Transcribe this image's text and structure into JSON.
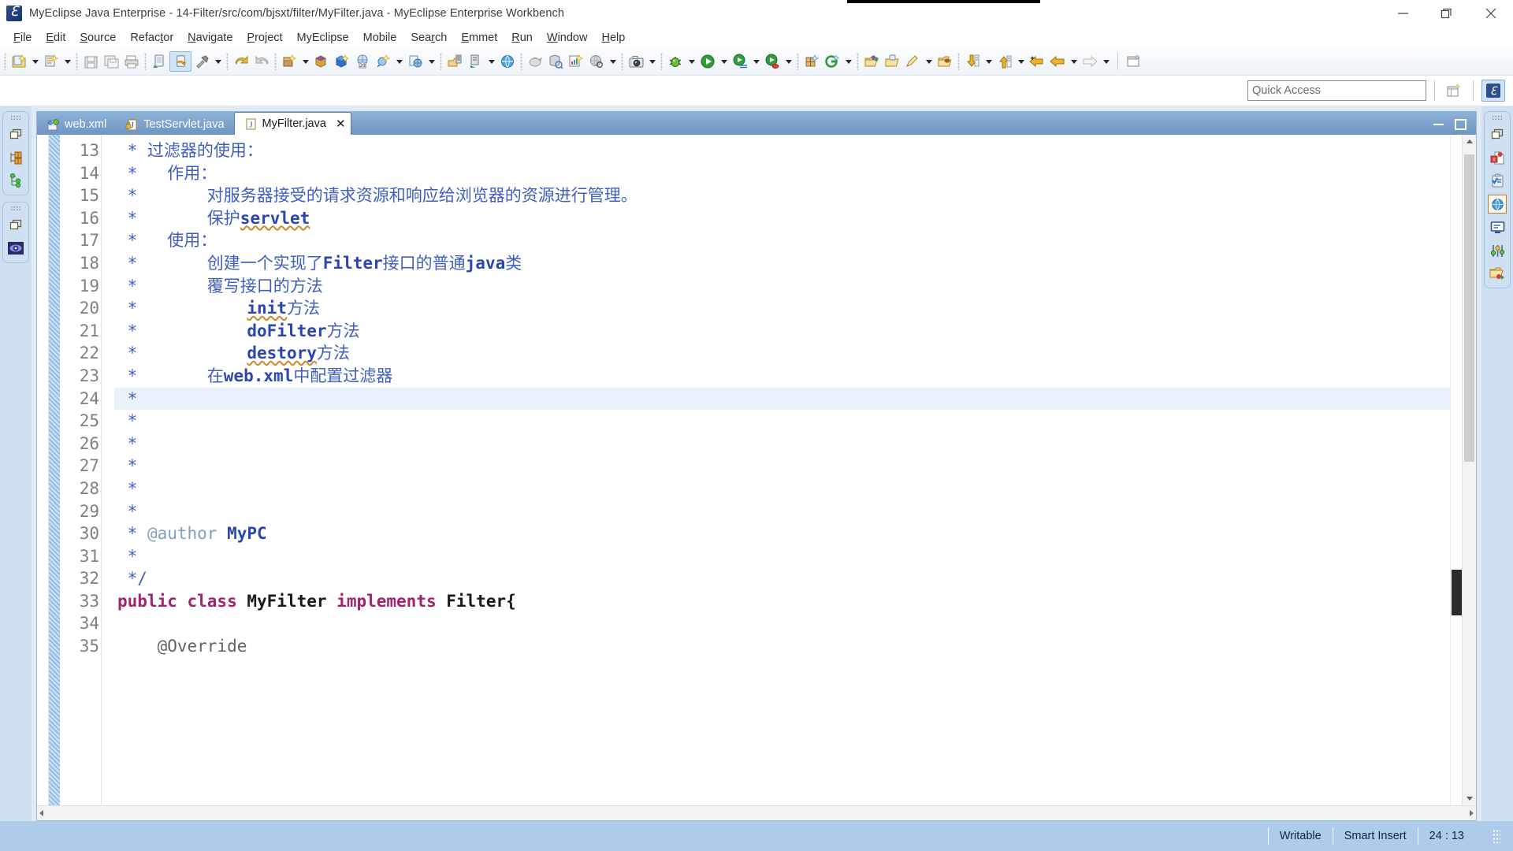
{
  "window": {
    "title": "MyEclipse Java Enterprise - 14-Filter/src/com/bjsxt/filter/MyFilter.java - MyEclipse Enterprise Workbench",
    "app_icon": "myeclipse-icon",
    "minimize_label": "Minimize",
    "restore_label": "Restore",
    "close_label": "Close"
  },
  "menubar": {
    "items": [
      {
        "label": "File",
        "mnemonic": "F"
      },
      {
        "label": "Edit",
        "mnemonic": "E"
      },
      {
        "label": "Source",
        "mnemonic": "S"
      },
      {
        "label": "Refactor",
        "mnemonic": "t"
      },
      {
        "label": "Navigate",
        "mnemonic": "N"
      },
      {
        "label": "Project",
        "mnemonic": "P"
      },
      {
        "label": "MyEclipse",
        "mnemonic": ""
      },
      {
        "label": "Mobile",
        "mnemonic": ""
      },
      {
        "label": "Search",
        "mnemonic": "r"
      },
      {
        "label": "Emmet",
        "mnemonic": "E"
      },
      {
        "label": "Run",
        "mnemonic": "R"
      },
      {
        "label": "Window",
        "mnemonic": "W"
      },
      {
        "label": "Help",
        "mnemonic": "H"
      }
    ]
  },
  "toolbar": {
    "groups": [
      {
        "buttons": [
          {
            "icon": "new-java-project-icon",
            "dropdown": true,
            "selected": false
          },
          {
            "icon": "new-wizard-icon",
            "dropdown": true,
            "selected": false
          }
        ]
      },
      {
        "buttons": [
          {
            "icon": "save-icon",
            "dropdown": false,
            "selected": false
          },
          {
            "icon": "save-all-icon",
            "dropdown": false,
            "selected": false
          },
          {
            "icon": "print-icon",
            "dropdown": false,
            "selected": false
          }
        ]
      },
      {
        "buttons": [
          {
            "icon": "deploy-icon",
            "dropdown": false,
            "selected": false
          },
          {
            "icon": "run-server-icon",
            "dropdown": false,
            "selected": true
          },
          {
            "icon": "build-hammer-icon",
            "dropdown": true,
            "selected": false
          }
        ]
      },
      {
        "buttons": [
          {
            "icon": "undo-icon",
            "dropdown": false,
            "selected": false
          },
          {
            "icon": "redo-icon",
            "dropdown": false,
            "selected": false
          }
        ]
      },
      {
        "buttons": [
          {
            "icon": "new-package-icon",
            "dropdown": true,
            "selected": false
          },
          {
            "icon": "new-class-icon",
            "dropdown": false,
            "selected": false
          },
          {
            "icon": "new-interface-icon",
            "dropdown": false,
            "selected": false
          },
          {
            "icon": "open-type-icon",
            "dropdown": false,
            "selected": false
          },
          {
            "icon": "new-snippet-icon",
            "dropdown": true,
            "selected": false
          },
          {
            "icon": "new-web-icon",
            "dropdown": true,
            "selected": false
          }
        ]
      },
      {
        "buttons": [
          {
            "icon": "export-server-icon",
            "dropdown": false,
            "selected": false
          },
          {
            "icon": "deploy-server-icon",
            "dropdown": true,
            "selected": false
          },
          {
            "icon": "open-browser-icon",
            "dropdown": false,
            "selected": false
          }
        ]
      },
      {
        "buttons": [
          {
            "icon": "piggy-bank-icon",
            "dropdown": false,
            "selected": false
          },
          {
            "icon": "db-browser-icon",
            "dropdown": false,
            "selected": false
          },
          {
            "icon": "report-designer-icon",
            "dropdown": false,
            "selected": false
          },
          {
            "icon": "globe-search-icon",
            "dropdown": true,
            "selected": false
          }
        ]
      },
      {
        "buttons": [
          {
            "icon": "camera-snapshot-icon",
            "dropdown": true,
            "selected": false
          }
        ]
      },
      {
        "buttons": [
          {
            "icon": "debug-bug-icon",
            "dropdown": true,
            "selected": false
          },
          {
            "icon": "run-icon",
            "dropdown": true,
            "selected": false
          },
          {
            "icon": "run-config-icon",
            "dropdown": true,
            "selected": false
          },
          {
            "icon": "run-coverage-icon",
            "dropdown": true,
            "selected": false
          }
        ]
      },
      {
        "buttons": [
          {
            "icon": "new-visual-icon",
            "dropdown": false,
            "selected": false
          },
          {
            "icon": "genuitec-icon",
            "dropdown": true,
            "selected": false
          }
        ]
      },
      {
        "buttons": [
          {
            "icon": "open-resource-icon",
            "dropdown": false,
            "selected": false
          },
          {
            "icon": "open-task-icon",
            "dropdown": false,
            "selected": false
          },
          {
            "icon": "edit-tag-icon",
            "dropdown": true,
            "selected": false
          },
          {
            "icon": "open-folder-icon",
            "dropdown": false,
            "selected": false
          }
        ]
      },
      {
        "buttons": [
          {
            "icon": "next-annotation-icon",
            "dropdown": true,
            "selected": false
          },
          {
            "icon": "previous-annotation-icon",
            "dropdown": true,
            "selected": false
          },
          {
            "icon": "back-history-icon",
            "dropdown": false,
            "selected": false
          },
          {
            "icon": "backward-icon",
            "dropdown": true,
            "selected": false
          },
          {
            "icon": "forward-icon",
            "dropdown": true,
            "selected": false
          }
        ]
      },
      {
        "buttons": [
          {
            "icon": "new-window-icon",
            "dropdown": false,
            "selected": false
          }
        ]
      }
    ]
  },
  "quick_access": {
    "placeholder": "Quick Access",
    "value": "",
    "perspective_open_icon": "open-perspective-icon",
    "perspective_active_icon": "myeclipse-perspective-icon"
  },
  "left_rail": {
    "groups": [
      {
        "icons": [
          "restore-view-icon",
          "package-explorer-icon",
          "outline-tree-icon"
        ]
      },
      {
        "icons": [
          "restore-view-icon",
          "myeclipse-explorer-icon"
        ]
      }
    ]
  },
  "right_rail": {
    "groups": [
      {
        "icons": [
          "restore-view-icon",
          "problems-icon",
          "tasks-icon",
          "web-browser-icon",
          "console-icon",
          "properties-icon",
          "servers-icon"
        ]
      }
    ]
  },
  "editor": {
    "tabs": [
      {
        "label": "web.xml",
        "icon": "xml-file-icon",
        "active": false,
        "closable": false
      },
      {
        "label": "TestServlet.java",
        "icon": "java-file-locked-icon",
        "active": false,
        "closable": false
      },
      {
        "label": "MyFilter.java",
        "icon": "java-file-icon",
        "active": true,
        "closable": true
      }
    ],
    "tab_minimize": "minimize-editor",
    "tab_maximize": "maximize-editor",
    "first_line": 13,
    "highlighted_line": 24,
    "folded_lines": [
      35
    ],
    "lines": [
      {
        "n": 13,
        "tokens": [
          {
            "t": "comment",
            "s": " * 过滤器的使用："
          }
        ]
      },
      {
        "n": 14,
        "tokens": [
          {
            "t": "comment",
            "s": " *   作用："
          }
        ]
      },
      {
        "n": 15,
        "tokens": [
          {
            "t": "comment",
            "s": " *       对服务器接受的请求资源和响应给浏览器的资源进行管理。"
          }
        ]
      },
      {
        "n": 16,
        "tokens": [
          {
            "t": "comment",
            "s": " *       保护"
          },
          {
            "t": "comment-spell",
            "s": "servlet"
          }
        ]
      },
      {
        "n": 17,
        "tokens": [
          {
            "t": "comment",
            "s": " *   使用："
          }
        ]
      },
      {
        "n": 18,
        "tokens": [
          {
            "t": "comment",
            "s": " *       创建一个实现了"
          },
          {
            "t": "comment-bold",
            "s": "Filter"
          },
          {
            "t": "comment",
            "s": "接口的普通"
          },
          {
            "t": "comment-bold",
            "s": "java"
          },
          {
            "t": "comment",
            "s": "类"
          }
        ]
      },
      {
        "n": 19,
        "tokens": [
          {
            "t": "comment",
            "s": " *       覆写接口的方法"
          }
        ]
      },
      {
        "n": 20,
        "tokens": [
          {
            "t": "comment",
            "s": " *           "
          },
          {
            "t": "comment-spell",
            "s": "init"
          },
          {
            "t": "comment",
            "s": "方法"
          }
        ]
      },
      {
        "n": 21,
        "tokens": [
          {
            "t": "comment",
            "s": " *           "
          },
          {
            "t": "comment-bold",
            "s": "doFilter"
          },
          {
            "t": "comment",
            "s": "方法"
          }
        ]
      },
      {
        "n": 22,
        "tokens": [
          {
            "t": "comment",
            "s": " *           "
          },
          {
            "t": "comment-spell",
            "s": "destory"
          },
          {
            "t": "comment",
            "s": "方法"
          }
        ]
      },
      {
        "n": 23,
        "tokens": [
          {
            "t": "comment",
            "s": " *       在"
          },
          {
            "t": "comment-bold",
            "s": "web.xml"
          },
          {
            "t": "comment",
            "s": "中配置过滤器"
          }
        ]
      },
      {
        "n": 24,
        "tokens": [
          {
            "t": "comment",
            "s": " *"
          }
        ]
      },
      {
        "n": 25,
        "tokens": [
          {
            "t": "comment",
            "s": " *"
          }
        ]
      },
      {
        "n": 26,
        "tokens": [
          {
            "t": "comment",
            "s": " *"
          }
        ]
      },
      {
        "n": 27,
        "tokens": [
          {
            "t": "comment",
            "s": " *"
          }
        ]
      },
      {
        "n": 28,
        "tokens": [
          {
            "t": "comment",
            "s": " *"
          }
        ]
      },
      {
        "n": 29,
        "tokens": [
          {
            "t": "comment",
            "s": " *"
          }
        ]
      },
      {
        "n": 30,
        "tokens": [
          {
            "t": "comment",
            "s": " * "
          },
          {
            "t": "javadoc-tag",
            "s": "@author"
          },
          {
            "t": "comment-bold",
            "s": " MyPC"
          }
        ]
      },
      {
        "n": 31,
        "tokens": [
          {
            "t": "comment",
            "s": " *"
          }
        ]
      },
      {
        "n": 32,
        "tokens": [
          {
            "t": "comment",
            "s": " */"
          }
        ]
      },
      {
        "n": 33,
        "tokens": [
          {
            "t": "keyword",
            "s": "public class "
          },
          {
            "t": "plain",
            "s": "MyFilter "
          },
          {
            "t": "keyword",
            "s": "implements "
          },
          {
            "t": "plain",
            "s": "Filter{"
          }
        ]
      },
      {
        "n": 34,
        "tokens": [
          {
            "t": "plain",
            "s": ""
          }
        ]
      },
      {
        "n": 35,
        "tokens": [
          {
            "t": "plain",
            "s": "    "
          },
          {
            "t": "annotation",
            "s": "@Override"
          }
        ]
      }
    ]
  },
  "statusbar": {
    "writable": "Writable",
    "insert_mode": "Smart Insert",
    "position": "24 : 13"
  },
  "colors": {
    "title_bar": "#ffffff",
    "toolbar_bg": "#eef2f7",
    "tab_active_bg": "#ffffff",
    "tab_inactive_bg": "#6e96c4",
    "status_bar": "#aecbea",
    "comment_blue": "#3f5fbf",
    "comment_bold_blue": "#2b46b0",
    "keyword_magenta": "#a0246e",
    "javadoc_tag": "#7f9fbf",
    "annotation_gray": "#646464",
    "line_number_gray": "#808080",
    "highlight_line": "#eaf2fb",
    "rail_bg": "#cfe0f2"
  }
}
